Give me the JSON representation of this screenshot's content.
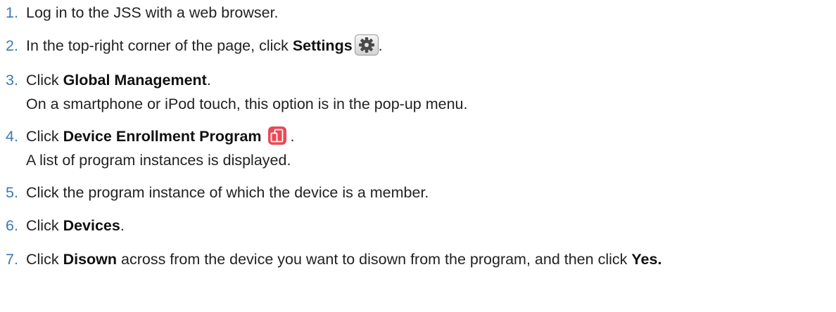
{
  "steps": [
    {
      "number": "1.",
      "text": "Log in to the JSS with a web browser."
    },
    {
      "number": "2.",
      "prefix": "In the top-right corner of the page, click ",
      "bold": "Settings",
      "icon": "gear-icon",
      "suffix": "."
    },
    {
      "number": "3.",
      "prefix": "Click ",
      "bold": "Global Management",
      "suffix": ".",
      "note": "On a smartphone or iPod touch, this option is in the pop-up menu."
    },
    {
      "number": "4.",
      "prefix": "Click ",
      "bold": "Device Enrollment Program",
      "icon": "device-enrollment-icon",
      "suffix": ".",
      "note": "A list of program instances is displayed."
    },
    {
      "number": "5.",
      "text": "Click the program instance of which the device is a member."
    },
    {
      "number": "6.",
      "prefix": "Click ",
      "bold": "Devices",
      "suffix": "."
    },
    {
      "number": "7.",
      "prefix": "Click ",
      "bold": "Disown",
      "middle": " across from the device you want to disown from the program, and then click ",
      "bold2": "Yes",
      "suffix": "."
    }
  ],
  "colors": {
    "step_number": "#3b79b5",
    "text": "#222222",
    "dep_icon": "#e84a57"
  }
}
